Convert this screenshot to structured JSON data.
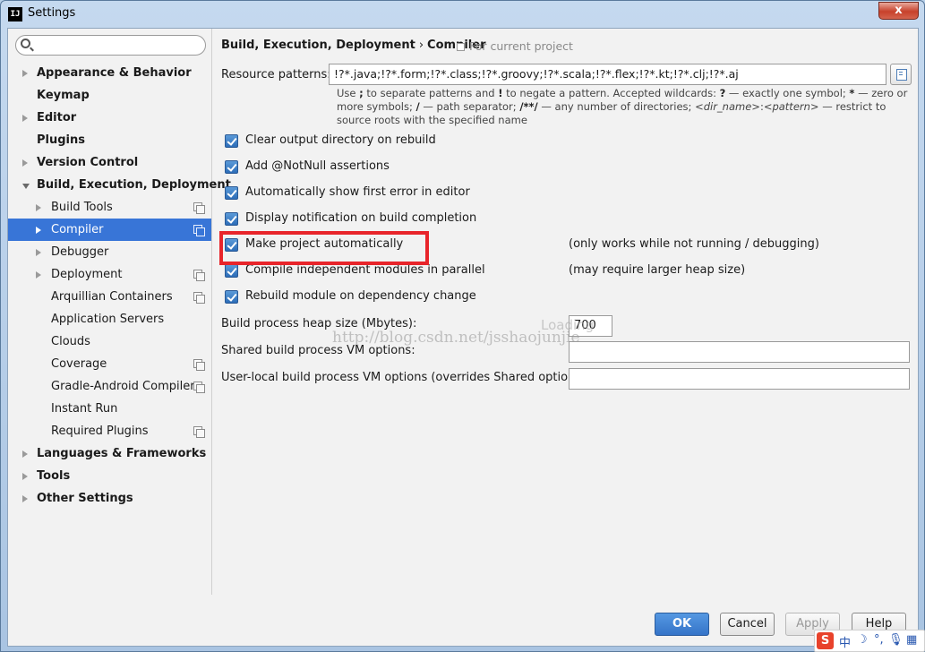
{
  "window": {
    "title": "Settings",
    "close_glyph": "x",
    "app_icon_text": "IJ"
  },
  "sidebar": {
    "search_placeholder": "",
    "items": [
      {
        "label": "Appearance & Behavior",
        "bold": true,
        "level": 0,
        "arrow": "right",
        "copy": false,
        "selected": false
      },
      {
        "label": "Keymap",
        "bold": true,
        "level": 0,
        "arrow": "none",
        "copy": false,
        "selected": false
      },
      {
        "label": "Editor",
        "bold": true,
        "level": 0,
        "arrow": "right",
        "copy": false,
        "selected": false
      },
      {
        "label": "Plugins",
        "bold": true,
        "level": 0,
        "arrow": "none",
        "copy": false,
        "selected": false
      },
      {
        "label": "Version Control",
        "bold": true,
        "level": 0,
        "arrow": "right",
        "copy": false,
        "selected": false
      },
      {
        "label": "Build, Execution, Deployment",
        "bold": true,
        "level": 0,
        "arrow": "down",
        "copy": false,
        "selected": false
      },
      {
        "label": "Build Tools",
        "bold": false,
        "level": 1,
        "arrow": "right",
        "copy": true,
        "selected": false
      },
      {
        "label": "Compiler",
        "bold": false,
        "level": 1,
        "arrow": "right",
        "copy": true,
        "selected": true
      },
      {
        "label": "Debugger",
        "bold": false,
        "level": 1,
        "arrow": "right",
        "copy": false,
        "selected": false
      },
      {
        "label": "Deployment",
        "bold": false,
        "level": 1,
        "arrow": "right",
        "copy": true,
        "selected": false
      },
      {
        "label": "Arquillian Containers",
        "bold": false,
        "level": 1,
        "arrow": "none",
        "copy": true,
        "selected": false
      },
      {
        "label": "Application Servers",
        "bold": false,
        "level": 1,
        "arrow": "none",
        "copy": false,
        "selected": false
      },
      {
        "label": "Clouds",
        "bold": false,
        "level": 1,
        "arrow": "none",
        "copy": false,
        "selected": false
      },
      {
        "label": "Coverage",
        "bold": false,
        "level": 1,
        "arrow": "none",
        "copy": true,
        "selected": false
      },
      {
        "label": "Gradle-Android Compiler",
        "bold": false,
        "level": 1,
        "arrow": "none",
        "copy": true,
        "selected": false
      },
      {
        "label": "Instant Run",
        "bold": false,
        "level": 1,
        "arrow": "none",
        "copy": false,
        "selected": false
      },
      {
        "label": "Required Plugins",
        "bold": false,
        "level": 1,
        "arrow": "none",
        "copy": true,
        "selected": false
      },
      {
        "label": "Languages & Frameworks",
        "bold": true,
        "level": 0,
        "arrow": "right",
        "copy": false,
        "selected": false
      },
      {
        "label": "Tools",
        "bold": true,
        "level": 0,
        "arrow": "right",
        "copy": false,
        "selected": false
      },
      {
        "label": "Other Settings",
        "bold": true,
        "level": 0,
        "arrow": "right",
        "copy": false,
        "selected": false
      }
    ]
  },
  "main": {
    "breadcrumb": {
      "parent": "Build, Execution, Deployment",
      "separator": "›",
      "current": "Compiler"
    },
    "scope_label": "For current project",
    "resource_patterns": {
      "label": "Resource patterns:",
      "value": "!?*.java;!?*.form;!?*.class;!?*.groovy;!?*.scala;!?*.flex;!?*.kt;!?*.clj;!?*.aj"
    },
    "help": {
      "t1": "Use ",
      "b1": ";",
      "t2": " to separate patterns and ",
      "b2": "!",
      "t3": " to negate a pattern. Accepted wildcards: ",
      "b3": "?",
      "t4": " — exactly one symbol; ",
      "b4": "*",
      "t5": " — zero or more symbols; ",
      "b5": "/",
      "t6": " — path separator; ",
      "b6": "/**/",
      "t7": " — any number of directories; ",
      "i1": "<dir_name>",
      "t8": ":",
      "i2": "<pattern>",
      "t9": " — restrict to source roots with the specified name"
    },
    "checkboxes": [
      {
        "label": "Clear output directory on rebuild",
        "checked": true,
        "hint": ""
      },
      {
        "label": "Add @NotNull assertions",
        "checked": true,
        "hint": ""
      },
      {
        "label": "Automatically show first error in editor",
        "checked": true,
        "hint": ""
      },
      {
        "label": "Display notification on build completion",
        "checked": true,
        "hint": ""
      },
      {
        "label": "Make project automatically",
        "checked": true,
        "hint": "(only works while not running / debugging)"
      },
      {
        "label": "Compile independent modules in parallel",
        "checked": true,
        "hint": "(may require larger heap size)"
      },
      {
        "label": "Rebuild module on dependency change",
        "checked": true,
        "hint": ""
      }
    ],
    "heap": {
      "label": "Build process heap size (Mbytes):",
      "value": "700"
    },
    "shared_vm": {
      "label": "Shared build process VM options:",
      "value": ""
    },
    "user_vm": {
      "label": "User-local build process VM options (overrides Shared options):",
      "value": ""
    },
    "watermark": "http://blog.csdn.net/jsshaojunjie",
    "loading_text": "Loading"
  },
  "footer": {
    "ok": "OK",
    "cancel": "Cancel",
    "apply": "Apply",
    "help": "Help"
  },
  "tray": {
    "s": "S",
    "zh": "中",
    "moon": "☽",
    "punct": "°,",
    "mic": "🎙",
    "grid": "▦"
  },
  "colors": {
    "selection": "#3875d7",
    "highlight_box": "#e8252b",
    "ok_button": "#3574c8"
  }
}
